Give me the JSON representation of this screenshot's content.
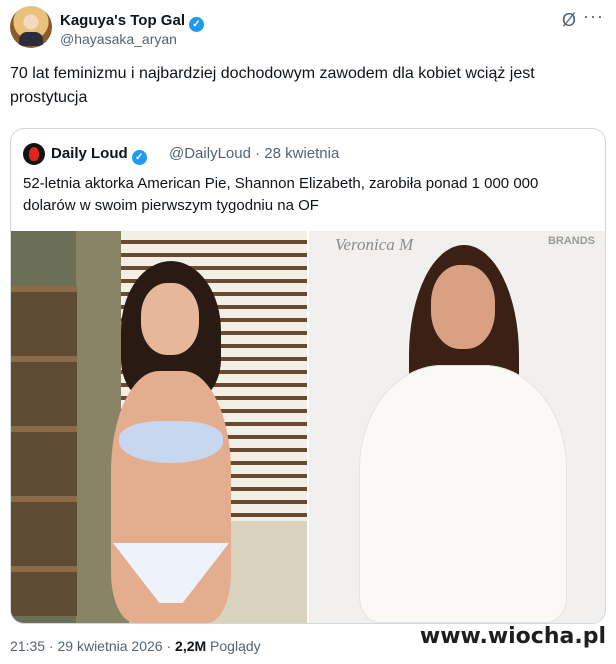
{
  "tweet": {
    "author_name": "Kaguya's Top Gal",
    "author_handle": "@hayasaka_aryan",
    "text": "70 lat feminizmu i najbardziej dochodowym zawodem dla kobiet wciąż jest prostytucja",
    "time": "21:35",
    "date": "29 kwietnia 2026",
    "views_count": "2,2M",
    "views_label": "Poglądy"
  },
  "quote": {
    "author_name": "Daily Loud",
    "handle_date": "@DailyLoud · 28 kwietnia",
    "text": "52-letnia aktorka American Pie, Shannon Elizabeth, zarobiła ponad 1 000 000 dolarów w swoim pierwszym tygodniu na OF",
    "photo_right_backdrop": "Veronica M",
    "photo_right_brand": "BRANDS"
  },
  "watermark": "www.wiocha.pl",
  "colors": {
    "verified": "#1d9bf0",
    "muted": "#536471",
    "border": "#cfd9de"
  }
}
